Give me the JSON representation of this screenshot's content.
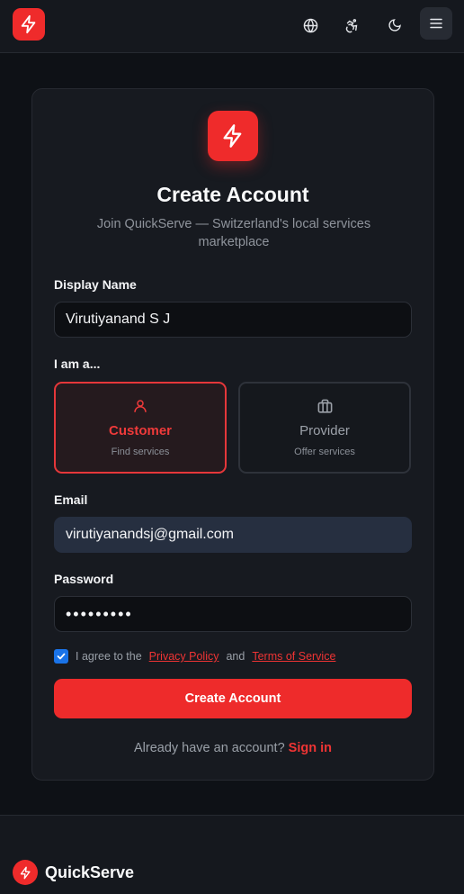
{
  "header": {
    "logo_icon": "lightning-bolt-icon",
    "icons": [
      "globe-icon",
      "accessibility-icon",
      "moon-icon",
      "menu-icon"
    ]
  },
  "card": {
    "title": "Create Account",
    "subtitle": "Join QuickServe — Switzerland's local services marketplace"
  },
  "form": {
    "display_name": {
      "label": "Display Name",
      "value": "Virutiyanand S J"
    },
    "role": {
      "label": "I am a...",
      "options": [
        {
          "name": "Customer",
          "sub": "Find services",
          "icon": "user-icon",
          "selected": true
        },
        {
          "name": "Provider",
          "sub": "Offer services",
          "icon": "briefcase-icon",
          "selected": false
        }
      ]
    },
    "email": {
      "label": "Email",
      "value": "virutiyanandsj@gmail.com"
    },
    "password": {
      "label": "Password",
      "value": "•••••••••"
    },
    "agree": {
      "checked": true,
      "prefix": "I agree to the",
      "privacy": "Privacy Policy",
      "and": "and",
      "terms": "Terms of Service"
    },
    "submit_label": "Create Account",
    "signin_prompt": "Already have an account?",
    "signin_link": "Sign in"
  },
  "footer": {
    "brand": "QuickServe"
  },
  "colors": {
    "accent": "#ef2b2b",
    "background": "#0e1116",
    "card": "#171a20"
  }
}
